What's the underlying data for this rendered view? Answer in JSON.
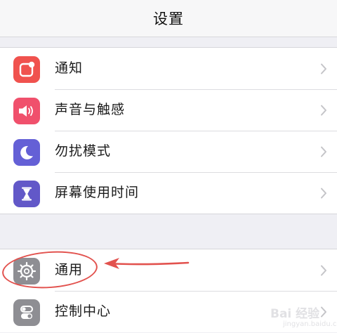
{
  "navbar": {
    "title": "设置"
  },
  "group1": {
    "items": [
      {
        "label": "通知",
        "icon": "notification-icon",
        "color": "#f0524e"
      },
      {
        "label": "声音与触感",
        "icon": "speaker-icon",
        "color": "#f0506c"
      },
      {
        "label": "勿扰模式",
        "icon": "moon-icon",
        "color": "#6460d6"
      },
      {
        "label": "屏幕使用时间",
        "icon": "hourglass-icon",
        "color": "#6258c8"
      }
    ]
  },
  "group2": {
    "items": [
      {
        "label": "通用",
        "icon": "gear-icon",
        "color": "#8e8e93"
      },
      {
        "label": "控制中心",
        "icon": "toggle-icon",
        "color": "#8e8e93"
      }
    ]
  },
  "annotation": {
    "color": "#e2524e"
  },
  "watermark": {
    "text": "Bai 经验",
    "sub": "jingyan.baidu.com"
  }
}
